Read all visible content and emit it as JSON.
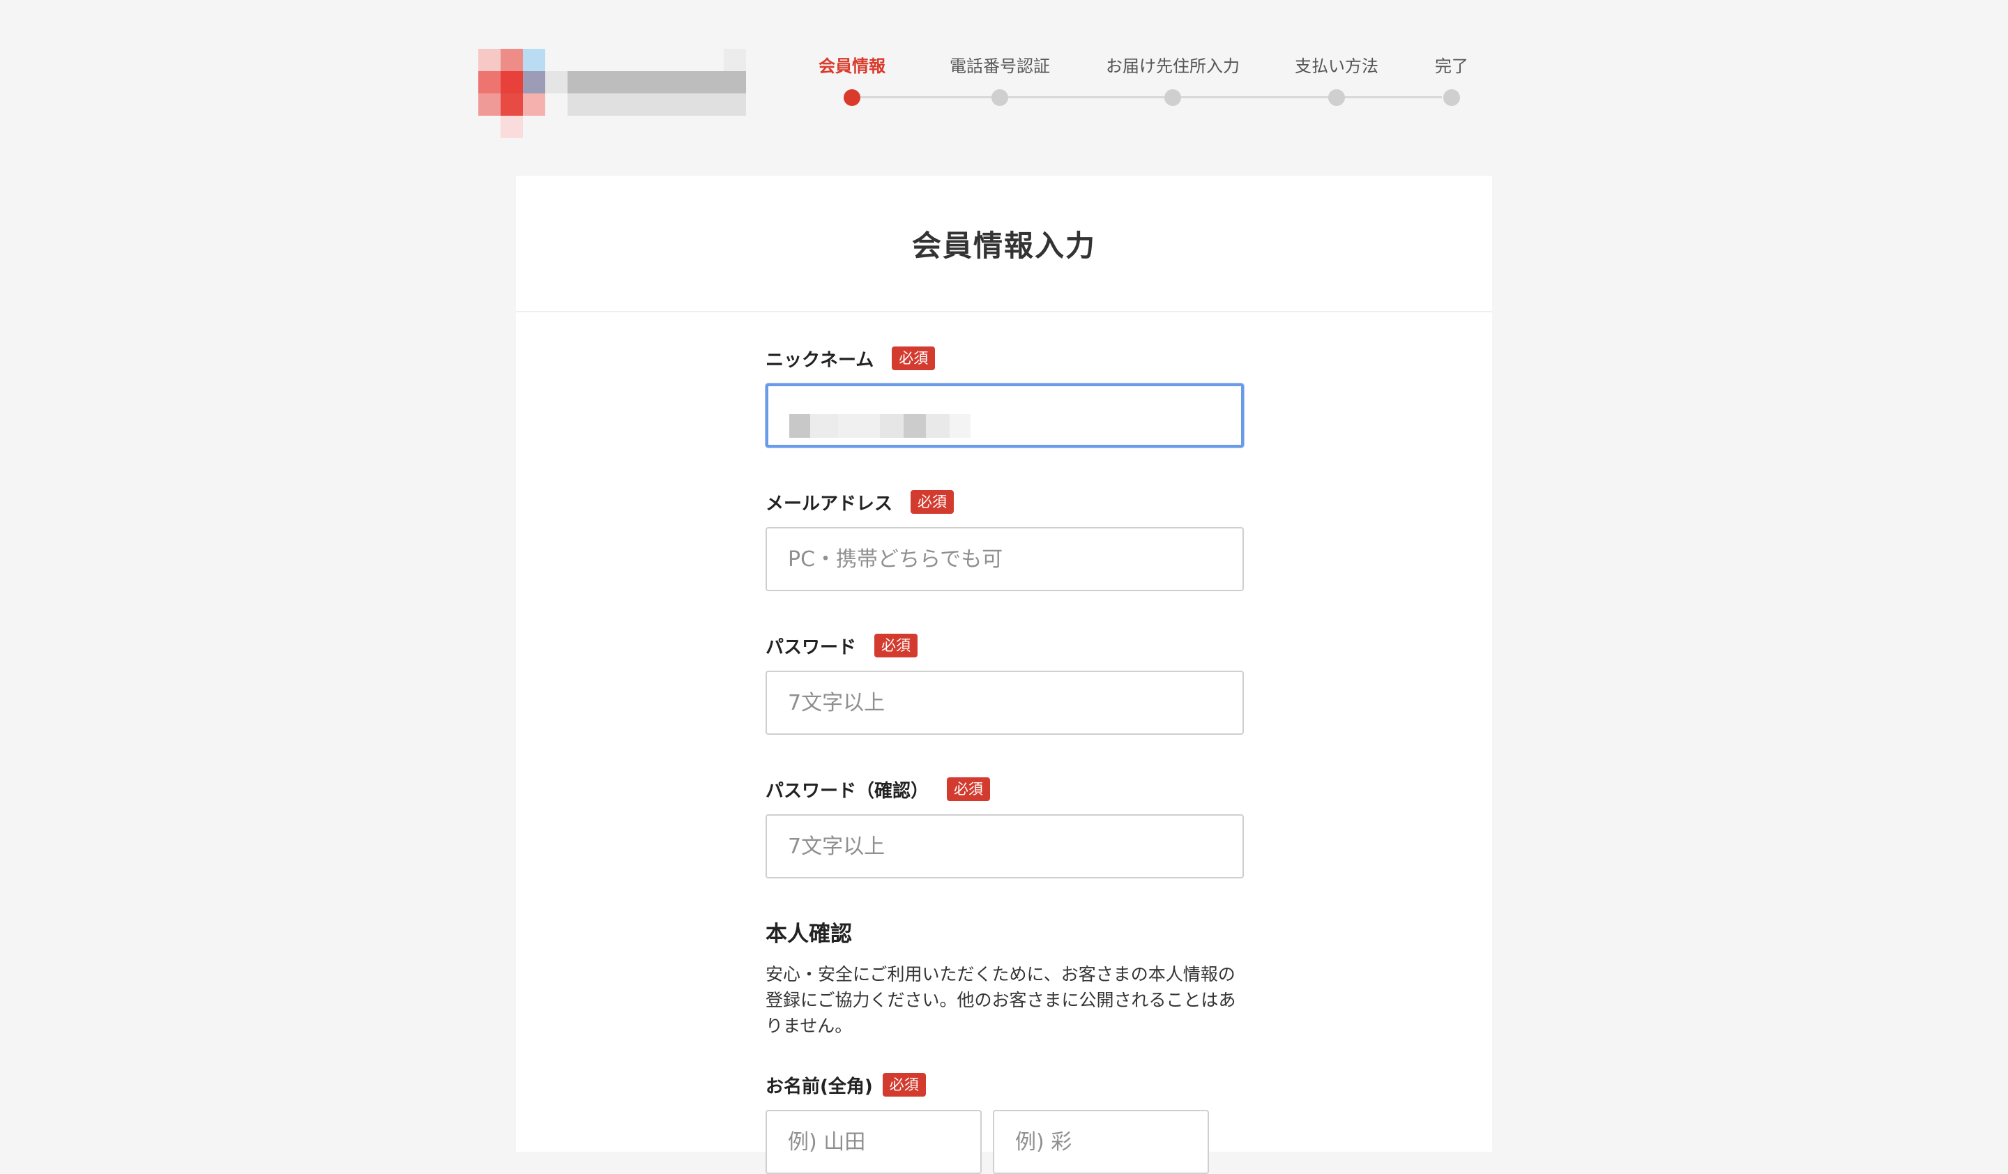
{
  "stepper": {
    "steps": [
      {
        "label": "会員情報",
        "active": true
      },
      {
        "label": "電話番号認証",
        "active": false
      },
      {
        "label": "お届け先住所入力",
        "active": false
      },
      {
        "label": "支払い方法",
        "active": false
      },
      {
        "label": "完了",
        "active": false
      }
    ]
  },
  "card": {
    "title": "会員情報入力"
  },
  "form": {
    "required_badge": "必須",
    "nickname": {
      "label": "ニックネーム",
      "value": ""
    },
    "email": {
      "label": "メールアドレス",
      "placeholder": "PC・携帯どちらでも可"
    },
    "password": {
      "label": "パスワード",
      "placeholder": "7文字以上"
    },
    "password_confirm": {
      "label": "パスワード（確認）",
      "placeholder": "7文字以上"
    },
    "identity": {
      "title": "本人確認",
      "description": "安心・安全にご利用いただくために、お客さまの本人情報の登録にご協力ください。他のお客さまに公開されることはありません。"
    },
    "fullname": {
      "label": "お名前(全角)",
      "last_placeholder": "例) 山田",
      "first_placeholder": "例) 彩"
    }
  },
  "colors": {
    "accent": "#d93a2b",
    "focus": "#6a9be8"
  }
}
